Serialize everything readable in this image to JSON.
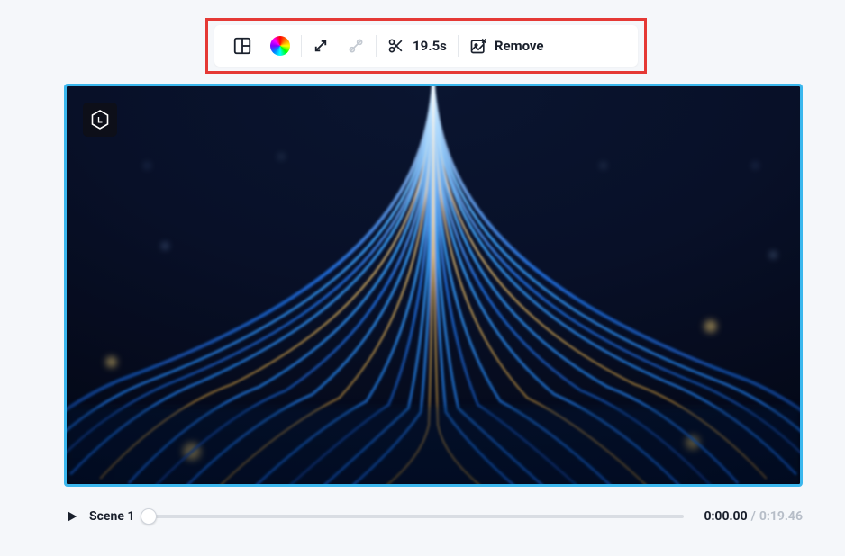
{
  "toolbar": {
    "layout_icon": "layout-icon",
    "color_icon": "color-wheel-icon",
    "expand_icon": "expand-icon",
    "adjust_icon": "adjust-icon",
    "trim_icon": "scissors-icon",
    "trim_label": "19.5s",
    "remove_icon": "image-remove-icon",
    "remove_label": "Remove"
  },
  "controls": {
    "scene_label": "Scene 1",
    "current_time": "0:00.00",
    "total_time": "0:19.46"
  }
}
